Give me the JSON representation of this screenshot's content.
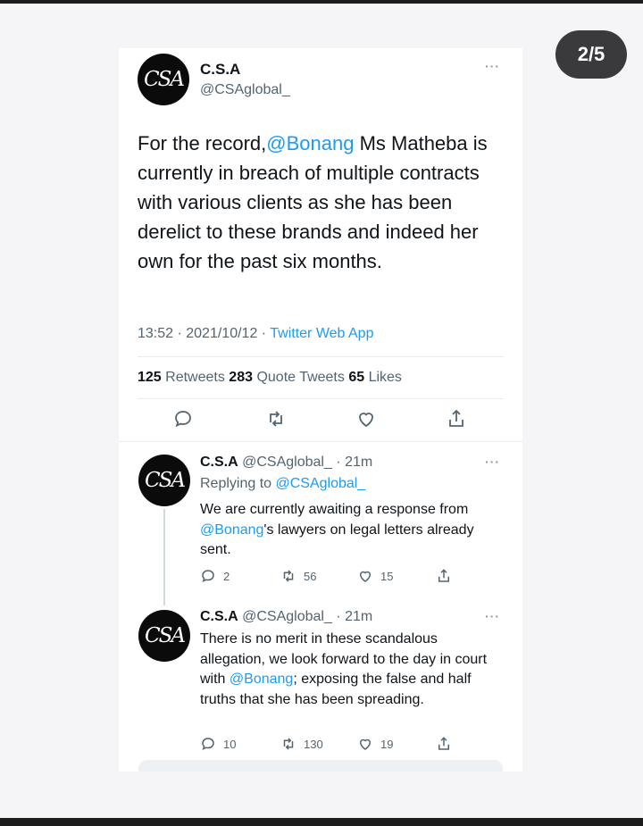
{
  "counter": "2/5",
  "main": {
    "avatar_text": "CSA",
    "name": "C.S.A",
    "handle": "@CSAglobal_",
    "more": "···",
    "text_before": "For the record,",
    "mention": "@Bonang",
    "text_after": " Ms Matheba is currently in breach of multiple contracts with various clients as she has been derelict to these brands and indeed her own for the past six months.",
    "time": "13:52 · 2021/10/12 · ",
    "app": "Twitter Web App",
    "retweets_count": "125",
    "retweets_label": " Retweets ",
    "quotes_count": "283",
    "quotes_label": " Quote Tweets ",
    "likes_count": "65",
    "likes_label": " Likes"
  },
  "replies": [
    {
      "avatar_text": "CSA",
      "name": "C.S.A",
      "meta": " @CSAglobal_ · 21m",
      "replying_label": "Replying to ",
      "replying_handle": "@CSAglobal_",
      "text_before": "We are currently awaiting a response from ",
      "mention": "@Bonang",
      "text_after": "'s lawyers on legal letters already sent.",
      "reply_count": "2",
      "retweet_count": "56",
      "like_count": "15"
    },
    {
      "avatar_text": "CSA",
      "name": "C.S.A",
      "meta": " @CSAglobal_ · 21m",
      "text_before": "There is no merit in these scandalous allegation, we  look forward to the day in court with ",
      "mention": "@Bonang",
      "text_after": "; exposing the false and half truths that she has been spreading.",
      "reply_count": "10",
      "retweet_count": "130",
      "like_count": "19"
    }
  ],
  "icons": [
    "reply-icon",
    "retweet-icon",
    "like-icon",
    "share-icon",
    "more-icon"
  ]
}
